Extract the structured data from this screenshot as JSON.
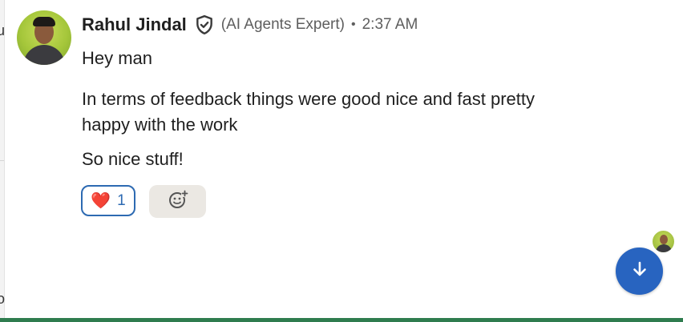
{
  "edge": {
    "glyph_top": "u",
    "glyph_bottom": "o"
  },
  "message": {
    "author": "Rahul Jindal",
    "role": "(AI Agents Expert)",
    "separator": "•",
    "time": "2:37 AM",
    "lines": [
      "Hey man",
      "In terms of feedback things were good nice and fast pretty happy with the work",
      "So nice stuff!"
    ],
    "reactions": [
      {
        "emoji": "❤️",
        "count": "1"
      }
    ]
  },
  "icons": {
    "verified_badge": "shield-check-icon",
    "add_reaction": "smiley-plus-icon",
    "scroll": "arrow-down-icon"
  },
  "colors": {
    "accent_blue": "#2864c0",
    "reaction_border": "#2d6ab2",
    "bottom_bar": "#2f7c4f"
  }
}
